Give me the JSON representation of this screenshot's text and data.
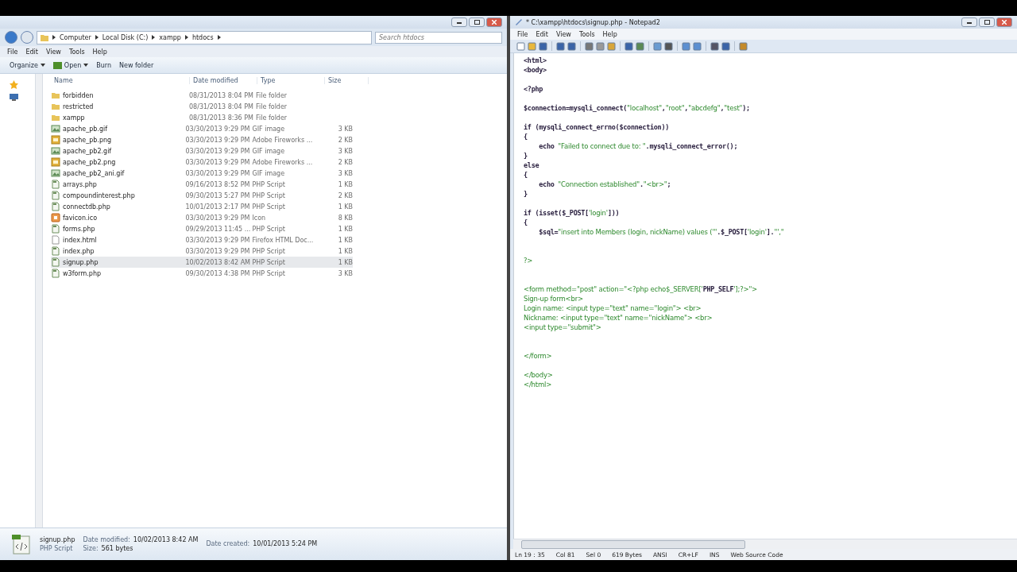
{
  "explorer": {
    "breadcrumb": [
      "Computer",
      "Local Disk (C:)",
      "xampp",
      "htdocs"
    ],
    "search": {
      "placeholder": "Search htdocs"
    },
    "menu": [
      "File",
      "Edit",
      "View",
      "Tools",
      "Help"
    ],
    "commands": [
      {
        "label": "Organize",
        "kind": "dropdown"
      },
      {
        "label": "Open",
        "kind": "open"
      },
      {
        "label": "Burn",
        "kind": "plain"
      },
      {
        "label": "New folder",
        "kind": "plain"
      }
    ],
    "columns": [
      "Name",
      "Date modified",
      "Type",
      "Size"
    ],
    "rows": [
      {
        "name": "forbidden",
        "date": "08/31/2013 8:04 PM",
        "type": "File folder",
        "kind": "folder",
        "selected": false
      },
      {
        "name": "restricted",
        "date": "08/31/2013 8:04 PM",
        "type": "File folder",
        "kind": "folder",
        "selected": false
      },
      {
        "name": "xampp",
        "date": "08/31/2013 8:36 PM",
        "type": "File folder",
        "kind": "folder",
        "selected": false
      },
      {
        "name": "apache_pb.gif",
        "date": "03/30/2013 9:29 PM",
        "type": "GIF image",
        "size": "3 KB",
        "kind": "image",
        "selected": false
      },
      {
        "name": "apache_pb.png",
        "date": "03/30/2013 9:29 PM",
        "type": "Adobe Fireworks ...",
        "size": "2 KB",
        "kind": "png",
        "selected": false
      },
      {
        "name": "apache_pb2.gif",
        "date": "03/30/2013 9:29 PM",
        "type": "GIF image",
        "size": "3 KB",
        "kind": "image",
        "selected": false
      },
      {
        "name": "apache_pb2.png",
        "date": "03/30/2013 9:29 PM",
        "type": "Adobe Fireworks ...",
        "size": "2 KB",
        "kind": "png",
        "selected": false
      },
      {
        "name": "apache_pb2_ani.gif",
        "date": "03/30/2013 9:29 PM",
        "type": "GIF image",
        "size": "3 KB",
        "kind": "image",
        "selected": false
      },
      {
        "name": "arrays.php",
        "date": "09/16/2013 8:52 PM",
        "type": "PHP Script",
        "size": "1 KB",
        "kind": "script",
        "selected": false
      },
      {
        "name": "compoundinterest.php",
        "date": "09/30/2013 5:27 PM",
        "type": "PHP Script",
        "size": "2 KB",
        "kind": "script",
        "selected": false
      },
      {
        "name": "connectdb.php",
        "date": "10/01/2013 2:17 PM",
        "type": "PHP Script",
        "size": "1 KB",
        "kind": "script",
        "selected": false
      },
      {
        "name": "favicon.ico",
        "date": "03/30/2013 9:29 PM",
        "type": "Icon",
        "size": "8 KB",
        "kind": "ico",
        "selected": false
      },
      {
        "name": "forms.php",
        "date": "09/29/2013 11:45 ...",
        "type": "PHP Script",
        "size": "1 KB",
        "kind": "script",
        "selected": false
      },
      {
        "name": "index.html",
        "date": "03/30/2013 9:29 PM",
        "type": "Firefox HTML Doc...",
        "size": "1 KB",
        "kind": "page",
        "selected": false
      },
      {
        "name": "index.php",
        "date": "03/30/2013 9:29 PM",
        "type": "PHP Script",
        "size": "1 KB",
        "kind": "script",
        "selected": false
      },
      {
        "name": "signup.php",
        "date": "10/02/2013 8:42 AM",
        "type": "PHP Script",
        "size": "1 KB",
        "kind": "script",
        "selected": true
      },
      {
        "name": "w3form.php",
        "date": "09/30/2013 4:38 PM",
        "type": "PHP Script",
        "size": "3 KB",
        "kind": "script",
        "selected": false
      }
    ],
    "details": {
      "name": "signup.php",
      "type": "PHP Script",
      "modified_label": "Date modified:",
      "modified": "10/02/2013 8:42 AM",
      "created_label": "Date created:",
      "created": "10/01/2013 5:24 PM",
      "size_label": "Size:",
      "size": "561 bytes"
    }
  },
  "notepad": {
    "title": "* C:\\xampp\\htdocs\\signup.php - Notepad2",
    "menu": [
      "File",
      "Edit",
      "View",
      "Tools",
      "Help"
    ],
    "lines": [
      {
        "kind": "text",
        "segments": [
          {
            "kind": "code",
            "text": "<html>"
          }
        ]
      },
      {
        "kind": "text",
        "segments": [
          {
            "kind": "code",
            "text": "<body>"
          }
        ]
      },
      {
        "kind": "blank"
      },
      {
        "kind": "text",
        "segments": [
          {
            "kind": "code",
            "text": "<?php"
          }
        ]
      },
      {
        "kind": "blank"
      },
      {
        "kind": "text",
        "segments": [
          {
            "kind": "code",
            "text": "$connection=mysqli_connect("
          },
          {
            "kind": "string",
            "text": "\"localhost\""
          },
          {
            "kind": "code",
            "text": ","
          },
          {
            "kind": "string",
            "text": "\"root\""
          },
          {
            "kind": "code",
            "text": ","
          },
          {
            "kind": "string",
            "text": "\"abcdefg\""
          },
          {
            "kind": "code",
            "text": ","
          },
          {
            "kind": "string",
            "text": "\"test\""
          },
          {
            "kind": "code",
            "text": ");"
          }
        ]
      },
      {
        "kind": "blank"
      },
      {
        "kind": "text",
        "segments": [
          {
            "kind": "code",
            "text": "if (mysqli_connect_errno($connection))"
          }
        ]
      },
      {
        "kind": "text",
        "segments": [
          {
            "kind": "code",
            "text": "{"
          }
        ]
      },
      {
        "kind": "text",
        "segments": [
          {
            "kind": "code",
            "text": "    echo "
          },
          {
            "kind": "string",
            "text": "\"Failed to connect due to: \""
          },
          {
            "kind": "code",
            "text": ".mysqli_connect_error();"
          }
        ]
      },
      {
        "kind": "text",
        "segments": [
          {
            "kind": "code",
            "text": "}"
          }
        ]
      },
      {
        "kind": "text",
        "segments": [
          {
            "kind": "code",
            "text": "else"
          }
        ]
      },
      {
        "kind": "text",
        "segments": [
          {
            "kind": "code",
            "text": "{"
          }
        ]
      },
      {
        "kind": "text",
        "segments": [
          {
            "kind": "code",
            "text": "    echo "
          },
          {
            "kind": "string",
            "text": "\"Connection established\""
          },
          {
            "kind": "code",
            "text": "."
          },
          {
            "kind": "string",
            "text": "\"<br>\""
          },
          {
            "kind": "code",
            "text": ";"
          }
        ]
      },
      {
        "kind": "text",
        "segments": [
          {
            "kind": "code",
            "text": "}"
          }
        ]
      },
      {
        "kind": "blank"
      },
      {
        "kind": "text",
        "segments": [
          {
            "kind": "code",
            "text": "if (isset($_POST["
          },
          {
            "kind": "string",
            "text": "'login'"
          },
          {
            "kind": "code",
            "text": "]))"
          }
        ]
      },
      {
        "kind": "text",
        "segments": [
          {
            "kind": "code",
            "text": "{"
          }
        ]
      },
      {
        "kind": "text",
        "segments": [
          {
            "kind": "code",
            "text": "    $sql="
          },
          {
            "kind": "string",
            "text": "\"insert into Members (login, nickName) values ('\""
          },
          {
            "kind": "code",
            "text": ".$_POST["
          },
          {
            "kind": "string",
            "text": "'login'"
          },
          {
            "kind": "code",
            "text": "]."
          },
          {
            "kind": "string",
            "text": "\"',\""
          }
        ]
      },
      {
        "kind": "blank"
      },
      {
        "kind": "blank"
      },
      {
        "kind": "text",
        "segments": [
          {
            "kind": "string",
            "text": "?>"
          }
        ]
      },
      {
        "kind": "blank"
      },
      {
        "kind": "blank"
      },
      {
        "kind": "text",
        "segments": [
          {
            "kind": "string",
            "text": "<form method=\"post\" action=\"<?php echo$_SERVER['"
          },
          {
            "kind": "code",
            "text": "PHP_SELF"
          },
          {
            "kind": "string",
            "text": "'];?>\">"
          }
        ]
      },
      {
        "kind": "text",
        "segments": [
          {
            "kind": "string",
            "text": "Sign-up form<br>"
          }
        ]
      },
      {
        "kind": "text",
        "segments": [
          {
            "kind": "string",
            "text": "Login name: <input type=\"text\" name=\"login\"> <br>"
          }
        ]
      },
      {
        "kind": "text",
        "segments": [
          {
            "kind": "string",
            "text": "Nickname: <input type=\"text\" name=\"nickName\"> <br>"
          }
        ]
      },
      {
        "kind": "text",
        "segments": [
          {
            "kind": "string",
            "text": "<input type=\"submit\">"
          }
        ]
      },
      {
        "kind": "blank"
      },
      {
        "kind": "blank"
      },
      {
        "kind": "text",
        "segments": [
          {
            "kind": "string",
            "text": "</form>"
          }
        ]
      },
      {
        "kind": "blank"
      },
      {
        "kind": "text",
        "segments": [
          {
            "kind": "string",
            "text": "</body>"
          }
        ]
      },
      {
        "kind": "text",
        "segments": [
          {
            "kind": "string",
            "text": "</html>"
          }
        ]
      }
    ],
    "status": [
      "Ln 19 : 35",
      "Col 81",
      "Sel 0",
      "619 Bytes",
      "ANSI",
      "CR+LF",
      "INS",
      "Web Source Code"
    ]
  }
}
